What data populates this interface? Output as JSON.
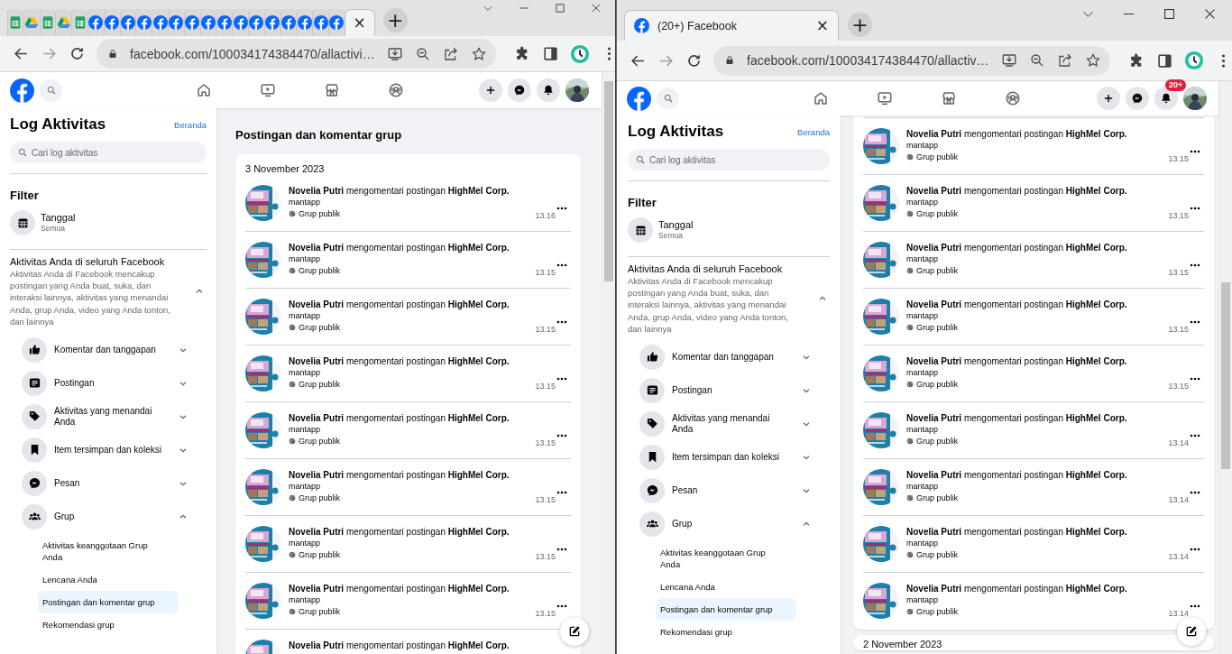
{
  "windows": [
    {
      "tabs": [
        {
          "kind": "sheets",
          "selected": false
        },
        {
          "kind": "drive",
          "selected": false
        },
        {
          "kind": "sheets",
          "selected": false
        },
        {
          "kind": "drive",
          "selected": false
        },
        {
          "kind": "sheets",
          "selected": false
        },
        {
          "kind": "facebook",
          "selected": false
        },
        {
          "kind": "facebook",
          "selected": false
        },
        {
          "kind": "facebook",
          "selected": false
        },
        {
          "kind": "facebook",
          "selected": false
        },
        {
          "kind": "facebook",
          "selected": false
        },
        {
          "kind": "facebook",
          "selected": false
        },
        {
          "kind": "facebook",
          "selected": false
        },
        {
          "kind": "facebook",
          "selected": false
        },
        {
          "kind": "facebook",
          "selected": false
        },
        {
          "kind": "facebook",
          "selected": false
        },
        {
          "kind": "facebook",
          "selected": false
        },
        {
          "kind": "facebook",
          "selected": false
        },
        {
          "kind": "facebook",
          "selected": false
        },
        {
          "kind": "facebook",
          "selected": false
        },
        {
          "kind": "facebook",
          "selected": false
        },
        {
          "kind": "facebook",
          "selected": false
        },
        {
          "kind": "none",
          "selected": true,
          "close": "×"
        }
      ],
      "new_tab": "+",
      "address": "facebook.com/100034174384470/allactivi…",
      "sidebar": {
        "title": "Log Aktivitas",
        "home_link": "Beranda",
        "search_placeholder": "Cari log aktivitas",
        "filter_heading": "Filter",
        "filters": [
          {
            "label": "Tanggal",
            "value": "Semua"
          }
        ],
        "section": {
          "title": "Aktivitas Anda di seluruh Facebook",
          "description": "Aktivitas Anda di Facebook mencakup postingan yang Anda buat, suka, dan interaksi lainnya, aktivitas yang menandai Anda, grup Anda, video yang Anda tonton, dan lainnya",
          "expanded": true
        },
        "categories": [
          {
            "kind": "like",
            "label": "Komentar dan tanggapan",
            "expanded": false
          },
          {
            "kind": "post",
            "label": "Postingan",
            "expanded": false
          },
          {
            "kind": "tag",
            "label": "Aktivitas yang menandai Anda",
            "expanded": false
          },
          {
            "kind": "bookmark",
            "label": "Item tersimpan dan koleksi",
            "expanded": false
          },
          {
            "kind": "messenger",
            "label": "Pesan",
            "expanded": false
          },
          {
            "kind": "group",
            "label": "Grup",
            "expanded": true,
            "children": [
              {
                "label": "Aktivitas keanggotaan Grup Anda",
                "selected": false
              },
              {
                "label": "Lencana Anda",
                "selected": false
              },
              {
                "label": "Postingan dan komentar grup",
                "selected": true
              },
              {
                "label": "Rekomendasi grup",
                "selected": false
              }
            ]
          }
        ]
      },
      "content": {
        "heading": "Postingan dan komentar grup",
        "cards": [
          {
            "date": "3 November 2023",
            "items": [
              {
                "title": "**Novelia Putri** mengomentari postingan **HighMel Corp.**",
                "comment": "mantapp",
                "audience": "Grup publik",
                "time": "13.16"
              },
              {
                "title": "**Novelia Putri** mengomentari postingan **HighMel Corp.**",
                "comment": "mantapp",
                "audience": "Grup publik",
                "time": "13.15"
              },
              {
                "title": "**Novelia Putri** mengomentari postingan **HighMel Corp.**",
                "comment": "mantapp",
                "audience": "Grup publik",
                "time": "13.15"
              },
              {
                "title": "**Novelia Putri** mengomentari postingan **HighMel Corp.**",
                "comment": "mantapp",
                "audience": "Grup publik",
                "time": "13.15"
              },
              {
                "title": "**Novelia Putri** mengomentari postingan **HighMel Corp.**",
                "comment": "mantapp",
                "audience": "Grup publik",
                "time": "13.15"
              },
              {
                "title": "**Novelia Putri** mengomentari postingan **HighMel Corp.**",
                "comment": "mantapp",
                "audience": "Grup publik",
                "time": "13.15"
              },
              {
                "title": "**Novelia Putri** mengomentari postingan **HighMel Corp.**",
                "comment": "mantapp",
                "audience": "Grup publik",
                "time": "13.15"
              },
              {
                "title": "**Novelia Putri** mengomentari postingan **HighMel Corp.**",
                "comment": "mantapp",
                "audience": "Grup publik",
                "time": "13.15"
              },
              {
                "title": "**Novelia Putri** mengomentari postingan **HighMel Corp.**"
              }
            ]
          }
        ]
      }
    },
    {
      "tabs": [
        {
          "kind": "facebook",
          "title": "(20+) Facebook",
          "selected": true,
          "close": "×"
        }
      ],
      "new_tab": "+",
      "address": "facebook.com/100034174384470/allactiv…",
      "header": {
        "notification_badge": "20+"
      },
      "sidebar": {
        "title": "Log Aktivitas",
        "home_link": "Beranda",
        "search_placeholder": "Cari log aktivitas",
        "filter_heading": "Filter",
        "filters": [
          {
            "label": "Tanggal",
            "value": "Semua"
          }
        ],
        "section": {
          "title": "Aktivitas Anda di seluruh Facebook",
          "description": "Aktivitas Anda di Facebook mencakup postingan yang Anda buat, suka, dan interaksi lainnya, aktivitas yang menandai Anda, grup Anda, video yang Anda tonton, dan lainnya",
          "expanded": true
        },
        "categories": [
          {
            "kind": "like",
            "label": "Komentar dan tanggapan",
            "expanded": false
          },
          {
            "kind": "post",
            "label": "Postingan",
            "expanded": false
          },
          {
            "kind": "tag",
            "label": "Aktivitas yang menandai Anda",
            "expanded": false
          },
          {
            "kind": "bookmark",
            "label": "Item tersimpan dan koleksi",
            "expanded": false
          },
          {
            "kind": "messenger",
            "label": "Pesan",
            "expanded": false
          },
          {
            "kind": "group",
            "label": "Grup",
            "expanded": true,
            "children": [
              {
                "label": "Aktivitas keanggotaan Grup Anda",
                "selected": false
              },
              {
                "label": "Lencana Anda",
                "selected": false
              },
              {
                "label": "Postingan dan komentar grup",
                "selected": true
              },
              {
                "label": "Rekomendasi grup",
                "selected": false
              }
            ]
          }
        ]
      },
      "content": {
        "cards": [
          {
            "items": [
              {
                "title": "**Novelia Putri** mengomentari postingan **HighMel Corp.**",
                "comment": "mantapp",
                "audience": "Grup publik",
                "time": "13.15"
              },
              {
                "title": "**Novelia Putri** mengomentari postingan **HighMel Corp.**",
                "comment": "mantapp",
                "audience": "Grup publik",
                "time": "13.15"
              },
              {
                "title": "**Novelia Putri** mengomentari postingan **HighMel Corp.**",
                "comment": "mantapp",
                "audience": "Grup publik",
                "time": "13.15"
              },
              {
                "title": "**Novelia Putri** mengomentari postingan **HighMel Corp.**",
                "comment": "mantapp",
                "audience": "Grup publik",
                "time": "13.15"
              },
              {
                "title": "**Novelia Putri** mengomentari postingan **HighMel Corp.**",
                "comment": "mantapp",
                "audience": "Grup publik",
                "time": "13.15"
              },
              {
                "title": "**Novelia Putri** mengomentari postingan **HighMel Corp.**",
                "comment": "mantapp",
                "audience": "Grup publik",
                "time": "13.14"
              },
              {
                "title": "**Novelia Putri** mengomentari postingan **HighMel Corp.**",
                "comment": "mantapp",
                "audience": "Grup publik",
                "time": "13.14"
              },
              {
                "title": "**Novelia Putri** mengomentari postingan **HighMel Corp.**",
                "comment": "mantapp",
                "audience": "Grup publik",
                "time": "13.14"
              },
              {
                "title": "**Novelia Putri** mengomentari postingan **HighMel Corp.**",
                "comment": "mantapp",
                "audience": "Grup publik",
                "time": "13.14"
              }
            ]
          },
          {
            "date": "2 November 2023"
          }
        ]
      }
    }
  ]
}
